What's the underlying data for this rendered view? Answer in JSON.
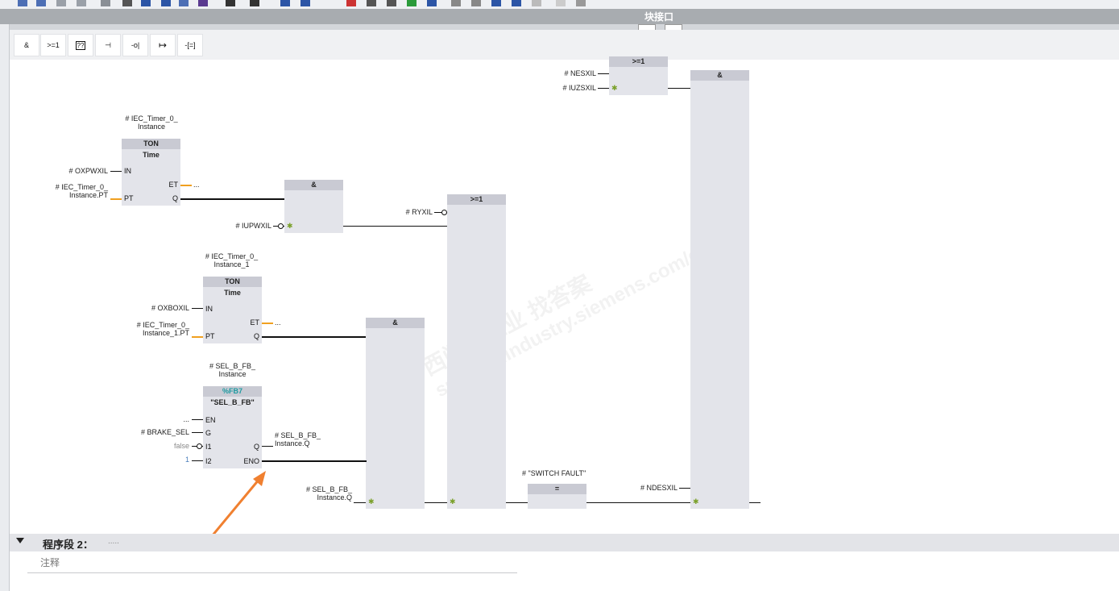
{
  "interface_header": {
    "title": "块接口"
  },
  "favorites": [
    "&",
    ">=1",
    "??",
    "⊣",
    "-o|",
    "↦",
    "-[=]"
  ],
  "blocks": {
    "ton1": {
      "instance": "# IEC_Timer_0_",
      "instance2": "Instance",
      "type": "TON",
      "subtype": "Time",
      "in_label": "IN",
      "pt_label": "PT",
      "et_label": "ET",
      "q_label": "Q",
      "in_operand": "# OXPWXIL",
      "pt_operand": "# IEC_Timer_0_",
      "pt_operand2": "Instance.PT",
      "et_operand": "..."
    },
    "ton2": {
      "instance": "# IEC_Timer_0_",
      "instance2": "Instance_1",
      "type": "TON",
      "subtype": "Time",
      "in_label": "IN",
      "pt_label": "PT",
      "et_label": "ET",
      "q_label": "Q",
      "in_operand": "# OXBOXIL",
      "pt_operand": "# IEC_Timer_0_",
      "pt_operand2": "Instance_1.PT",
      "et_operand": "..."
    },
    "selfb": {
      "instance": "# SEL_B_FB_",
      "instance2": "Instance",
      "fb_no": "%FB7",
      "name": "\"SEL_B_FB\"",
      "en_label": "EN",
      "g_label": "G",
      "i1_label": "I1",
      "i2_label": "I2",
      "q_label": "Q",
      "eno_label": "ENO",
      "en_operand": "...",
      "g_operand": "# BRAKE_SEL",
      "i1_operand": "false",
      "i2_operand": "1",
      "q_operand": "# SEL_B_FB_",
      "q_operand2": "Instance.Q"
    },
    "and1": {
      "label": "&",
      "in2_operand": "# IUPWXIL"
    },
    "and2": {
      "label": "&",
      "in_operand": "# SEL_B_FB_",
      "in_operand2": "Instance.Q"
    },
    "or1": {
      "label": ">=1",
      "in1_operand": "# RYXIL"
    },
    "or_top": {
      "label": ">=1",
      "in1_operand": "# NESXIL",
      "in2_operand": "# IUZSXIL"
    },
    "assign": {
      "label": "=",
      "operand": "# \"SWITCH FAULT\""
    },
    "and_big": {
      "label": "&",
      "in_operand": "# NDESXIL"
    }
  },
  "section2": {
    "title": "程序段 2：",
    "desc": ".....",
    "comment": "注释"
  },
  "watermark": {
    "line1": "西门子工业   找答案",
    "line2": "support.industry.siemens.com/cs"
  },
  "colors": {
    "accent": "#f08030",
    "header_grey": "#a8acb0",
    "block": "#e3e4ea",
    "block_header": "#c9cad3"
  }
}
